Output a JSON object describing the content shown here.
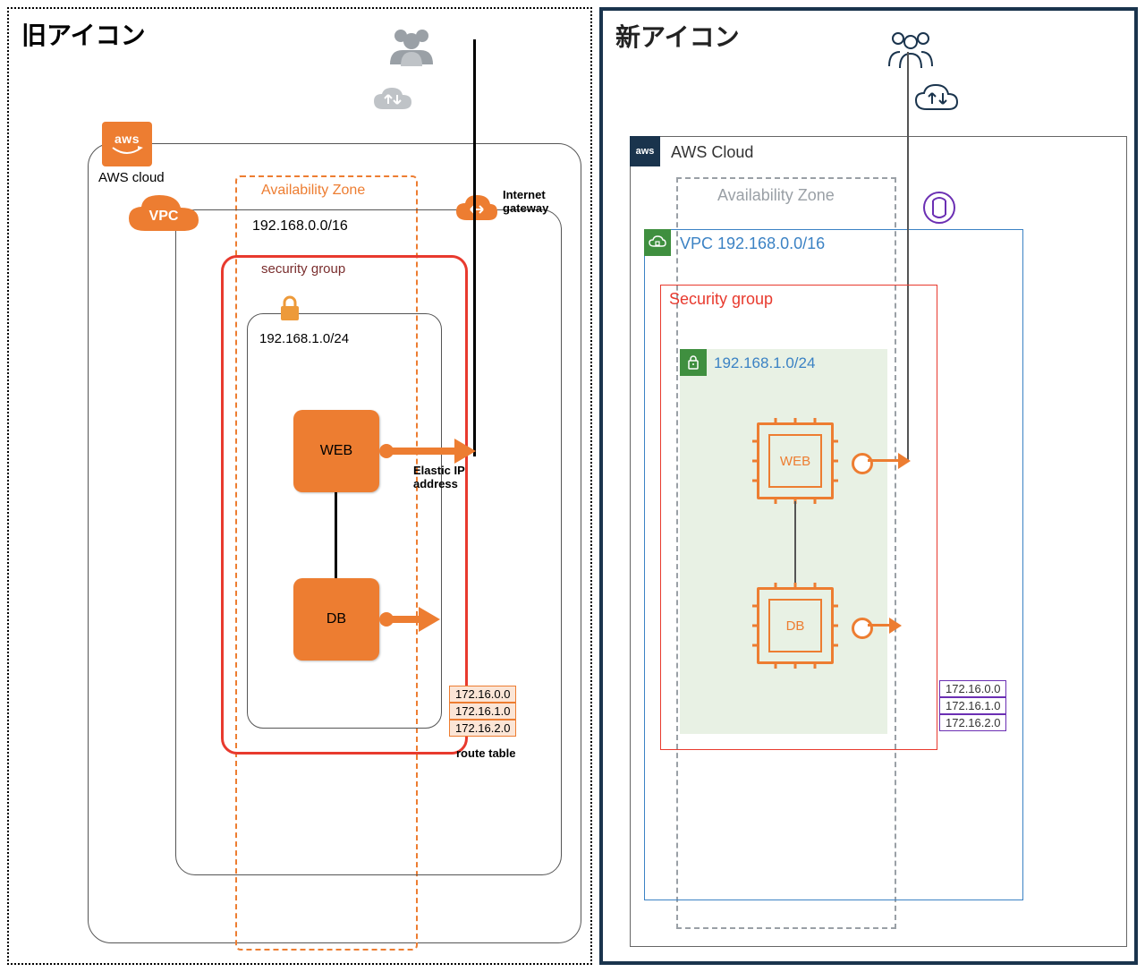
{
  "old": {
    "title": "旧アイコン",
    "aws_badge": "aws",
    "aws_label": "AWS cloud",
    "vpc_badge": "VPC",
    "vpc_cidr": "192.168.0.0/16",
    "az_label": "Availability Zone",
    "igw_label": "Internet\ngateway",
    "sg_label": "security group",
    "subnet_cidr": "192.168.1.0/24",
    "web_label": "WEB",
    "db_label": "DB",
    "eip_label": "Elastic IP\naddress",
    "route_table_label": "route table",
    "routes": [
      "172.16.0.0",
      "172.16.1.0",
      "172.16.2.0"
    ]
  },
  "new": {
    "title": "新アイコン",
    "aws_badge": "aws",
    "aws_label": "AWS Cloud",
    "az_label": "Availability Zone",
    "vpc_label": "VPC 192.168.0.0/16",
    "sg_label": "Security group",
    "subnet_cidr": "192.168.1.0/24",
    "web_label": "WEB",
    "db_label": "DB",
    "routes": [
      "172.16.0.0",
      "172.16.1.0",
      "172.16.2.0"
    ]
  },
  "colors": {
    "orange": "#ed7d31",
    "orange_dark": "#d96b1f",
    "red": "#e83a2e",
    "navy": "#1a344d",
    "grey": "#9aa0a6",
    "purple": "#6b2fb3",
    "green_soft": "#e8f1e4",
    "green_badge": "#3f8f3f",
    "blue_line": "#3b82c4",
    "maroon": "#7a2e2e"
  }
}
